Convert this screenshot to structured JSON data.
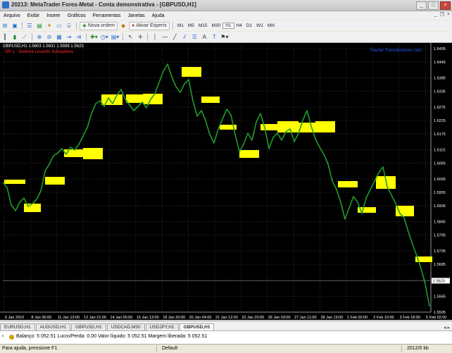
{
  "window": {
    "title": "20213: MetaTrader Forex-Metal - Conta demonstrativa - [GBPUSD,H1]",
    "controls": [
      "_",
      "□",
      "×"
    ]
  },
  "menu": {
    "items": [
      "Arquivo",
      "Exibir",
      "Inserir",
      "Gráficos",
      "Ferramentas",
      "Janelas",
      "Ajuda"
    ],
    "mdi_controls": [
      "_",
      "❐",
      "×"
    ]
  },
  "toolbar": {
    "new_order_label": "Nova ordem",
    "experts_label": "Ativar Experts",
    "timeframes": [
      "M1",
      "M5",
      "M15",
      "M30",
      "H1",
      "H4",
      "D1",
      "W1",
      "MN"
    ],
    "active_timeframe": "H1"
  },
  "chart": {
    "ohlc_text": "GBPUSD,H1  1.5603 1.5631 1.5598 1.5623",
    "indicator_text": "SR-1 - Sistema Levantis Indicadores",
    "link_text": "Fourier Transdicetorex.com",
    "price_labels": [
      "1.6495",
      "1.6445",
      "1.6385",
      "1.6335",
      "1.6275",
      "1.6225",
      "1.6175",
      "1.6115",
      "1.6065",
      "1.6005",
      "1.5955",
      "1.5905",
      "1.5845",
      "1.5795",
      "1.5735",
      "1.5685",
      "1.5625",
      "1.5565",
      "1.5505"
    ],
    "current_price": "1.5623",
    "time_labels": [
      "6 Jan 2010",
      "8 Jan 06:00",
      "11 Jan 13:00",
      "12 Jan 21:00",
      "14 Jan 05:00",
      "15 Jan 13:00",
      "18 Jan 20:00",
      "20 Jan 04:00",
      "21 Jan 12:00",
      "22 Jan 20:00",
      "26 Jan 03:00",
      "27 Jan 11:00",
      "28 Jan 19:00",
      "1 Feb 02:00",
      "2 Feb 10:00",
      "3 Feb 18:00",
      "5 Feb 02:00"
    ],
    "colors": {
      "background": "#000000",
      "grid": "#4d4d4d",
      "line": "#1f9c2a",
      "zones": "#ffff00",
      "text": "#ffffff"
    }
  },
  "tabs": {
    "items": [
      "EURUSD,H1",
      "AUDUSD,H1",
      "GBPUSD,H1",
      "USDCAD,M30",
      "USDJPY,H1",
      "GBPUSD,H1"
    ],
    "active_index": 5
  },
  "terminal": {
    "balance_text": "Balanço: 5 052.51  Lucro/Perda: 0.00  Valor líquido: 5 052.51  Margem liberada: 5 052.51"
  },
  "status": {
    "help_text": "Para ajuda, pressione F1",
    "profile_text": "Default",
    "connection_text": "2012/0 kb"
  }
}
